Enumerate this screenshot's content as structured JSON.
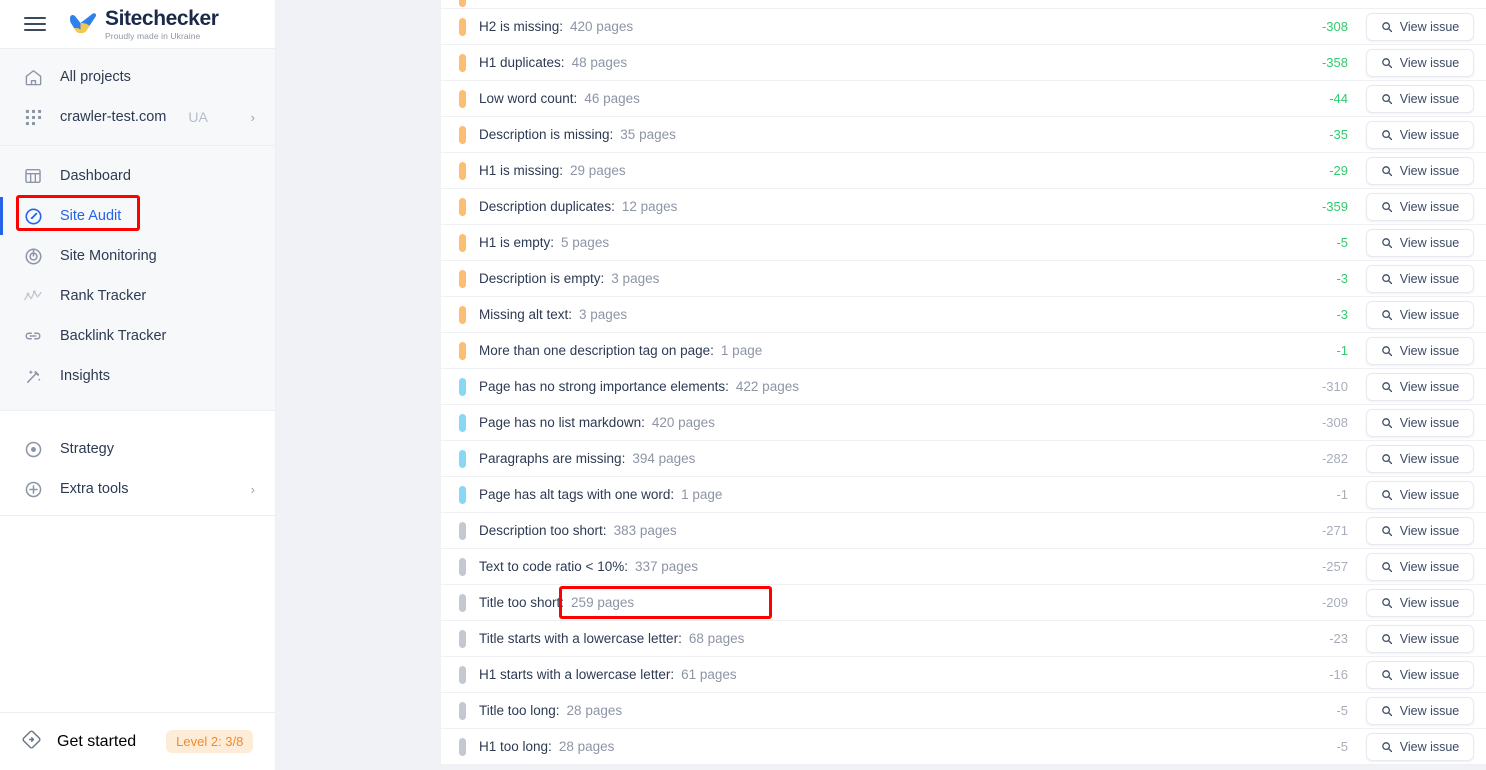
{
  "sidebar": {
    "menu_icon": "hamburger-menu-icon",
    "logo": {
      "title": "Sitechecker",
      "tagline": "Proudly made in Ukraine",
      "mark": "ukraine-check-icon"
    },
    "group_projects": [
      {
        "icon": "home-icon",
        "label": "All projects",
        "tag": "",
        "chevron": ""
      },
      {
        "icon": "grid-dots-icon",
        "label": "crawler-test.com",
        "tag": "UA",
        "chevron": "›"
      }
    ],
    "group_tools": [
      {
        "icon": "dashboard-icon",
        "label": "Dashboard",
        "active": false,
        "dim": false
      },
      {
        "icon": "speedometer-icon",
        "label": "Site Audit",
        "active": true,
        "dim": false
      },
      {
        "icon": "radar-icon",
        "label": "Site Monitoring",
        "active": false,
        "dim": false
      },
      {
        "icon": "rank-chart-icon",
        "label": "Rank Tracker",
        "active": false,
        "dim": true
      },
      {
        "icon": "link-icon",
        "label": "Backlink Tracker",
        "active": false,
        "dim": false
      },
      {
        "icon": "magic-wand-icon",
        "label": "Insights",
        "active": false,
        "dim": false
      }
    ],
    "group_extra": [
      {
        "icon": "target-icon",
        "label": "Strategy",
        "chevron": ""
      },
      {
        "icon": "plus-circle-icon",
        "label": "Extra tools",
        "chevron": "›"
      }
    ],
    "footer": {
      "icon": "rocket-badge-icon",
      "label": "Get started",
      "badge": "Level 2: 3/8"
    }
  },
  "main": {
    "view_issue_label": "View issue",
    "view_issue_icon": "search-icon",
    "rows": [
      {
        "severity": "orange",
        "label": "",
        "count": "",
        "score": "",
        "partial": true
      },
      {
        "severity": "orange",
        "label": "H2 is missing:",
        "count": "420 pages",
        "score": "-308",
        "score_color": "green"
      },
      {
        "severity": "orange",
        "label": "H1 duplicates:",
        "count": "48 pages",
        "score": "-358",
        "score_color": "green"
      },
      {
        "severity": "orange",
        "label": "Low word count:",
        "count": "46 pages",
        "score": "-44",
        "score_color": "green"
      },
      {
        "severity": "orange",
        "label": "Description is missing:",
        "count": "35 pages",
        "score": "-35",
        "score_color": "green"
      },
      {
        "severity": "orange",
        "label": "H1 is missing:",
        "count": "29 pages",
        "score": "-29",
        "score_color": "green"
      },
      {
        "severity": "orange",
        "label": "Description duplicates:",
        "count": "12 pages",
        "score": "-359",
        "score_color": "green"
      },
      {
        "severity": "orange",
        "label": "H1 is empty:",
        "count": "5 pages",
        "score": "-5",
        "score_color": "green"
      },
      {
        "severity": "orange",
        "label": "Description is empty:",
        "count": "3 pages",
        "score": "-3",
        "score_color": "green"
      },
      {
        "severity": "orange",
        "label": "Missing alt text:",
        "count": "3 pages",
        "score": "-3",
        "score_color": "green"
      },
      {
        "severity": "orange",
        "label": "More than one description tag on page:",
        "count": "1 page",
        "score": "-1",
        "score_color": "green"
      },
      {
        "severity": "blue",
        "label": "Page has no strong importance elements:",
        "count": "422 pages",
        "score": "-310",
        "score_color": "gray"
      },
      {
        "severity": "blue",
        "label": "Page has no list markdown:",
        "count": "420 pages",
        "score": "-308",
        "score_color": "gray"
      },
      {
        "severity": "blue",
        "label": "Paragraphs are missing:",
        "count": "394 pages",
        "score": "-282",
        "score_color": "gray"
      },
      {
        "severity": "blue",
        "label": "Page has alt tags with one word:",
        "count": "1 page",
        "score": "-1",
        "score_color": "gray"
      },
      {
        "severity": "gray",
        "label": "Description too short:",
        "count": "383 pages",
        "score": "-271",
        "score_color": "gray"
      },
      {
        "severity": "gray",
        "label": "Text to code ratio < 10%:",
        "count": "337 pages",
        "score": "-257",
        "score_color": "gray"
      },
      {
        "severity": "gray",
        "label": "Title too short:",
        "count": "259 pages",
        "score": "-209",
        "score_color": "gray",
        "highlighted": true
      },
      {
        "severity": "gray",
        "label": "Title starts with a lowercase letter:",
        "count": "68 pages",
        "score": "-23",
        "score_color": "gray"
      },
      {
        "severity": "gray",
        "label": "H1 starts with a lowercase letter:",
        "count": "61 pages",
        "score": "-16",
        "score_color": "gray"
      },
      {
        "severity": "gray",
        "label": "Title too long:",
        "count": "28 pages",
        "score": "-5",
        "score_color": "gray"
      },
      {
        "severity": "gray",
        "label": "H1 too long:",
        "count": "28 pages",
        "score": "-5",
        "score_color": "gray"
      }
    ]
  },
  "colors": {
    "accent_blue": "#2563eb",
    "severity_high": "#fbbe72",
    "severity_medium": "#88d7f5",
    "severity_low": "#c4c9d1",
    "score_positive": "#2fcc6f",
    "score_neutral": "#a7aebb",
    "highlight_box": "#ff0000",
    "badge_bg": "#fdecd8",
    "badge_text": "#ef8b2c"
  }
}
